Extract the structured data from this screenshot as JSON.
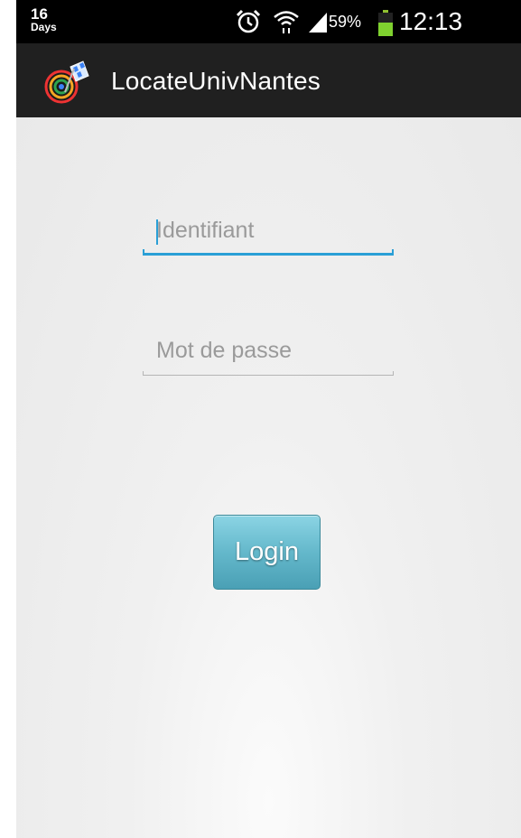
{
  "status_bar": {
    "days_number": "16",
    "days_label": "Days",
    "battery_percent": "59%",
    "battery_level": 0.59,
    "time": "12:13",
    "icons": [
      "alarm-icon",
      "wifi-icon",
      "signal-icon",
      "battery-icon"
    ]
  },
  "action_bar": {
    "app_title": "LocateUnivNantes",
    "logo_icon": "app-logo-icon"
  },
  "form": {
    "identifiant_placeholder": "Identifiant",
    "identifiant_value": "",
    "password_placeholder": "Mot de passe",
    "password_value": "",
    "login_label": "Login"
  },
  "colors": {
    "accent": "#2a9fd6",
    "button_top": "#8bd4e4",
    "button_bottom": "#4aa0b5",
    "actionbar": "#202020",
    "statusbar": "#000000"
  }
}
